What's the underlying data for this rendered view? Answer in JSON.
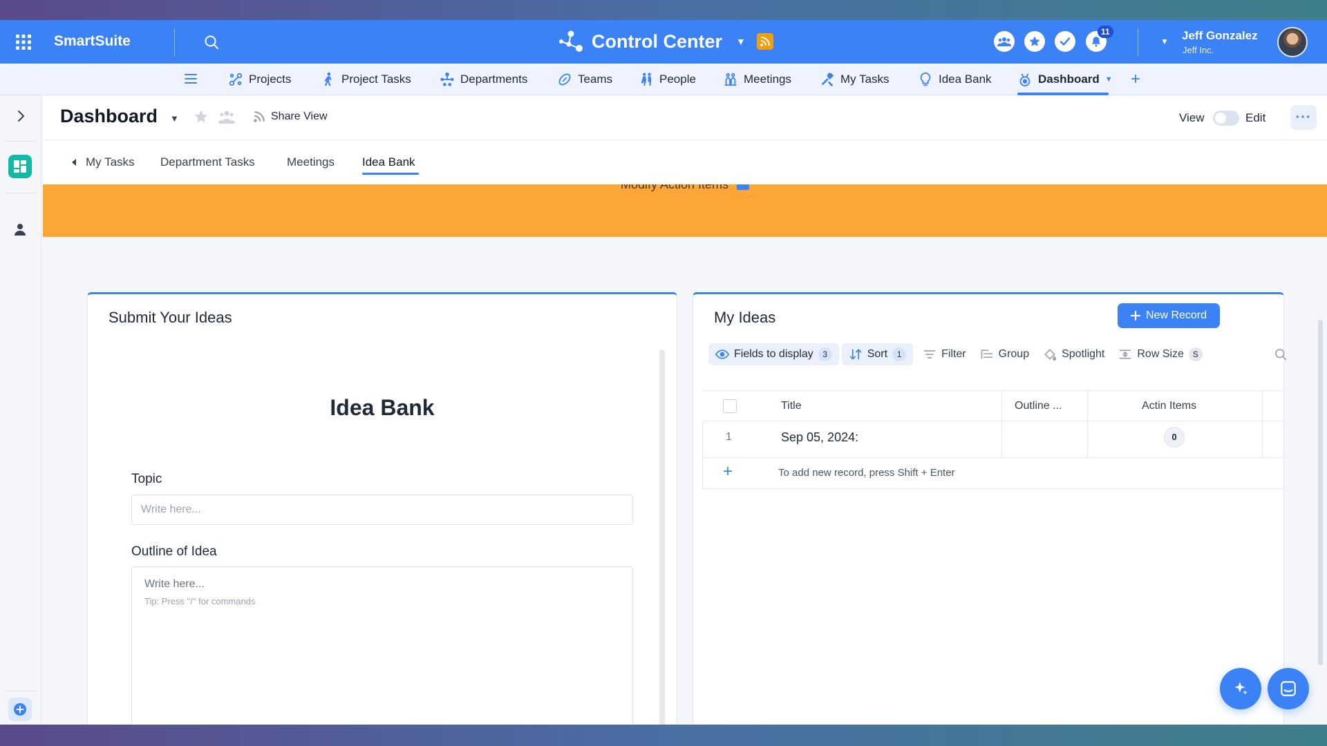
{
  "app": {
    "brand": "SmartSuite",
    "workspace_title": "Control Center",
    "notifications_count": "11",
    "user_name": "Jeff Gonzalez",
    "user_org": "Jeff Inc."
  },
  "colors": {
    "primary": "#3b82f6",
    "banner": "#fba636",
    "teal": "#14b8a6"
  },
  "nav": {
    "items": [
      {
        "label": "Projects",
        "icon": "projects-icon"
      },
      {
        "label": "Project Tasks",
        "icon": "person-walking-icon"
      },
      {
        "label": "Departments",
        "icon": "org-chart-icon"
      },
      {
        "label": "Teams",
        "icon": "football-icon"
      },
      {
        "label": "People",
        "icon": "people-running-icon"
      },
      {
        "label": "Meetings",
        "icon": "meeting-icon"
      },
      {
        "label": "My Tasks",
        "icon": "tools-icon"
      },
      {
        "label": "Idea Bank",
        "icon": "lightbulb-icon"
      },
      {
        "label": "Dashboard",
        "icon": "dashboard-icon",
        "active": true
      }
    ]
  },
  "dashboard": {
    "title": "Dashboard",
    "share_view": "Share View",
    "view_label": "View",
    "edit_label": "Edit",
    "tabs": [
      "My Tasks",
      "Department Tasks",
      "Meetings",
      "Idea Bank"
    ],
    "active_tab": "Idea Bank",
    "banner_text": "Modify Action Items"
  },
  "form": {
    "card_title": "Submit Your Ideas",
    "heading": "Idea Bank",
    "topic_label": "Topic",
    "topic_placeholder": "Write here...",
    "outline_label": "Outline of Idea",
    "outline_placeholder": "Write here...",
    "outline_tip": "Tip: Press \"/\" for commands"
  },
  "ideas": {
    "card_title": "My Ideas",
    "new_record_label": "New Record",
    "toolbar": {
      "fields_label": "Fields to display",
      "fields_count": "3",
      "sort_label": "Sort",
      "sort_count": "1",
      "filter_label": "Filter",
      "group_label": "Group",
      "spotlight_label": "Spotlight",
      "row_size_label": "Row Size",
      "row_size_value": "S"
    },
    "columns": [
      "Title",
      "Outline ...",
      "Actin Items"
    ],
    "rows": [
      {
        "num": "1",
        "title": "Sep 05, 2024:",
        "action_items": "0"
      }
    ],
    "add_hint": "To add new record, press Shift + Enter"
  }
}
